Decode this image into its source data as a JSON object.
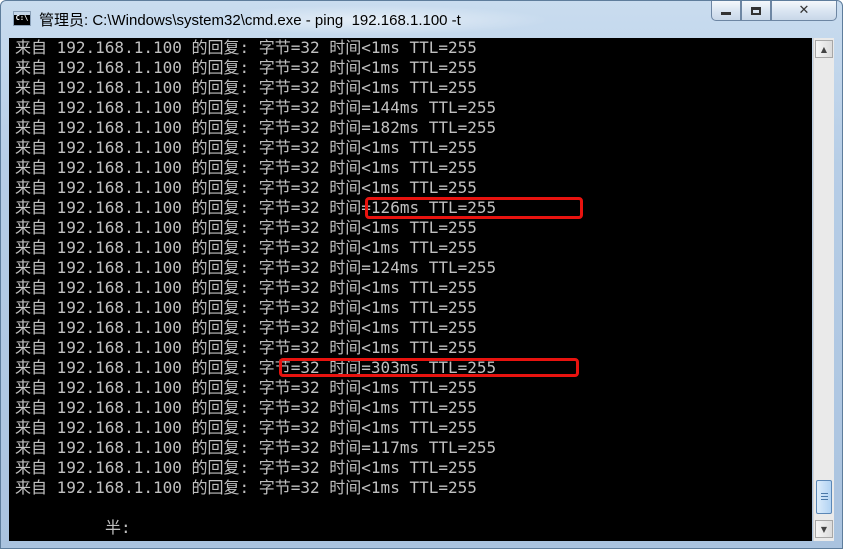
{
  "window": {
    "title": "管理员: C:\\Windows\\system32\\cmd.exe - ping  192.168.1.100 -t",
    "icon": "cmd-icon",
    "icon_text": "C:\\",
    "controls": [
      "minimize-icon",
      "maximize-icon",
      "close-icon"
    ],
    "close_glyph": "✕"
  },
  "console": {
    "lines": [
      "来自 192.168.1.100 的回复: 字节=32 时间<1ms TTL=255",
      "来自 192.168.1.100 的回复: 字节=32 时间<1ms TTL=255",
      "来自 192.168.1.100 的回复: 字节=32 时间<1ms TTL=255",
      "来自 192.168.1.100 的回复: 字节=32 时间=144ms TTL=255",
      "来自 192.168.1.100 的回复: 字节=32 时间=182ms TTL=255",
      "来自 192.168.1.100 的回复: 字节=32 时间<1ms TTL=255",
      "来自 192.168.1.100 的回复: 字节=32 时间<1ms TTL=255",
      "来自 192.168.1.100 的回复: 字节=32 时间<1ms TTL=255",
      "来自 192.168.1.100 的回复: 字节=32 时间=126ms TTL=255",
      "来自 192.168.1.100 的回复: 字节=32 时间<1ms TTL=255",
      "来自 192.168.1.100 的回复: 字节=32 时间<1ms TTL=255",
      "来自 192.168.1.100 的回复: 字节=32 时间=124ms TTL=255",
      "来自 192.168.1.100 的回复: 字节=32 时间<1ms TTL=255",
      "来自 192.168.1.100 的回复: 字节=32 时间<1ms TTL=255",
      "来自 192.168.1.100 的回复: 字节=32 时间<1ms TTL=255",
      "来自 192.168.1.100 的回复: 字节=32 时间<1ms TTL=255",
      "来自 192.168.1.100 的回复: 字节=32 时间=303ms TTL=255",
      "来自 192.168.1.100 的回复: 字节=32 时间<1ms TTL=255",
      "来自 192.168.1.100 的回复: 字节=32 时间<1ms TTL=255",
      "来自 192.168.1.100 的回复: 字节=32 时间<1ms TTL=255",
      "来自 192.168.1.100 的回复: 字节=32 时间=117ms TTL=255",
      "来自 192.168.1.100 的回复: 字节=32 时间<1ms TTL=255",
      "来自 192.168.1.100 的回复: 字节=32 时间<1ms TTL=255"
    ],
    "partial_text": "半:",
    "highlight_color": "#e8130f",
    "text_color": "#c0c0c0",
    "background": "#000000"
  },
  "scrollbar": {
    "up_glyph": "▲",
    "down_glyph": "▼"
  }
}
